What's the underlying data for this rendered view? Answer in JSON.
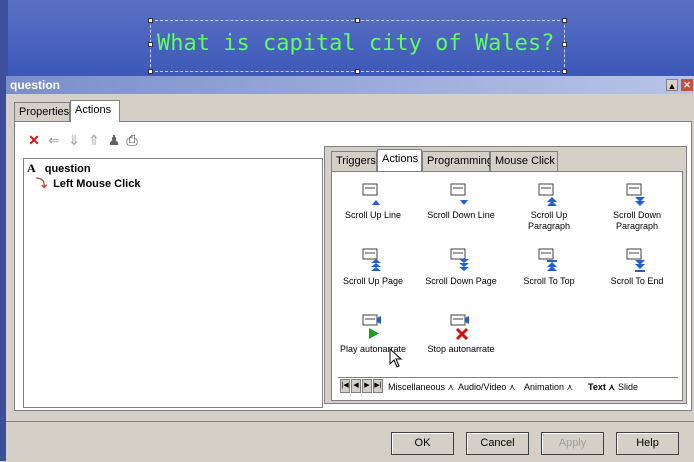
{
  "canvas": {
    "question_text": "What is capital city of Wales?"
  },
  "window": {
    "title": "question"
  },
  "main_tabs": [
    {
      "label": "Properties"
    },
    {
      "label": "Actions"
    }
  ],
  "toolbar_icons": [
    "delete-icon",
    "arrow-left-icon",
    "arrow-down-icon",
    "arrow-up-icon",
    "person-icon",
    "printer-icon"
  ],
  "tree": {
    "root": "question",
    "child": "Left Mouse Click"
  },
  "right_tabs": [
    {
      "label": "Triggers"
    },
    {
      "label": "Actions"
    },
    {
      "label": "Programming"
    },
    {
      "label": "Mouse Click"
    }
  ],
  "actions": [
    {
      "label": "Scroll Up Line"
    },
    {
      "label": "Scroll Down Line"
    },
    {
      "label": "Scroll Up Paragraph"
    },
    {
      "label": "Scroll Down Paragraph"
    },
    {
      "label": "Scroll Up Page"
    },
    {
      "label": "Scroll Down Page"
    },
    {
      "label": "Scroll To Top"
    },
    {
      "label": "Scroll To End"
    },
    {
      "label": "Play autonarrate"
    },
    {
      "label": "Stop autonarrate"
    }
  ],
  "category_tabs": [
    {
      "label": "Miscellaneous"
    },
    {
      "label": "Audio/Video"
    },
    {
      "label": "Animation"
    },
    {
      "label": "Text"
    },
    {
      "label": "Slide"
    }
  ],
  "buttons": {
    "ok": "OK",
    "cancel": "Cancel",
    "apply": "Apply",
    "help": "Help"
  },
  "colors": {
    "canvas_bg": "#4a64bf",
    "question_text": "#5cff5c",
    "icon_blue": "#1f5fd6",
    "play_green": "#1aa01a",
    "stop_red": "#d01010",
    "delete_red": "#e01010"
  }
}
